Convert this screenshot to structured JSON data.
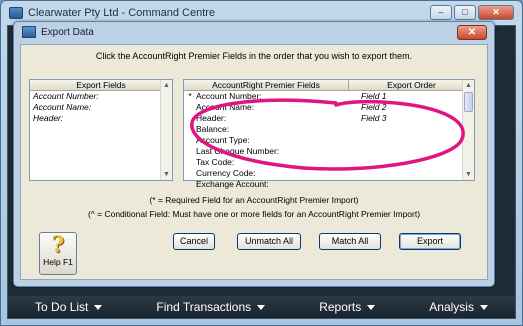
{
  "main_window": {
    "title": "Clearwater Pty Ltd - Command Centre",
    "buttons": [
      "minimize",
      "maximize",
      "close"
    ],
    "bottom_nav": [
      "To Do List",
      "Find Transactions",
      "Reports",
      "Analysis"
    ]
  },
  "dialog": {
    "title": "Export Data",
    "instruction": "Click the AccountRight Premier Fields in the order that you wish to export them.",
    "export_fields": {
      "header": "Export Fields",
      "items": [
        "Account Number:",
        "Account Name:",
        "Header:"
      ]
    },
    "premier_fields": {
      "header_name": "AccountRight Premier Fields",
      "header_order": "Export Order",
      "rows": [
        {
          "mark": "*",
          "name": "Account Number:",
          "order": "Field 1"
        },
        {
          "mark": "",
          "name": "Account Name:",
          "order": "Field 2"
        },
        {
          "mark": "",
          "name": "Header:",
          "order": "Field 3"
        },
        {
          "mark": "",
          "name": "Balance:",
          "order": ""
        },
        {
          "mark": "",
          "name": "Account Type:",
          "order": ""
        },
        {
          "mark": "",
          "name": "Last Cheque Number:",
          "order": ""
        },
        {
          "mark": "",
          "name": "Tax Code:",
          "order": ""
        },
        {
          "mark": "",
          "name": "Currency Code:",
          "order": ""
        },
        {
          "mark": "",
          "name": "Exchange Account:",
          "order": ""
        }
      ]
    },
    "note_required": "(* = Required Field for an AccountRight Premier Import)",
    "note_conditional": "(^ = Conditional Field: Must have one or more fields for an AccountRight Premier Import)",
    "help_label": "Help F1",
    "buttons": {
      "cancel": "Cancel",
      "unmatch_all": "Unmatch All",
      "match_all": "Match All",
      "export": "Export"
    },
    "annotation_color": "#e0157f"
  }
}
